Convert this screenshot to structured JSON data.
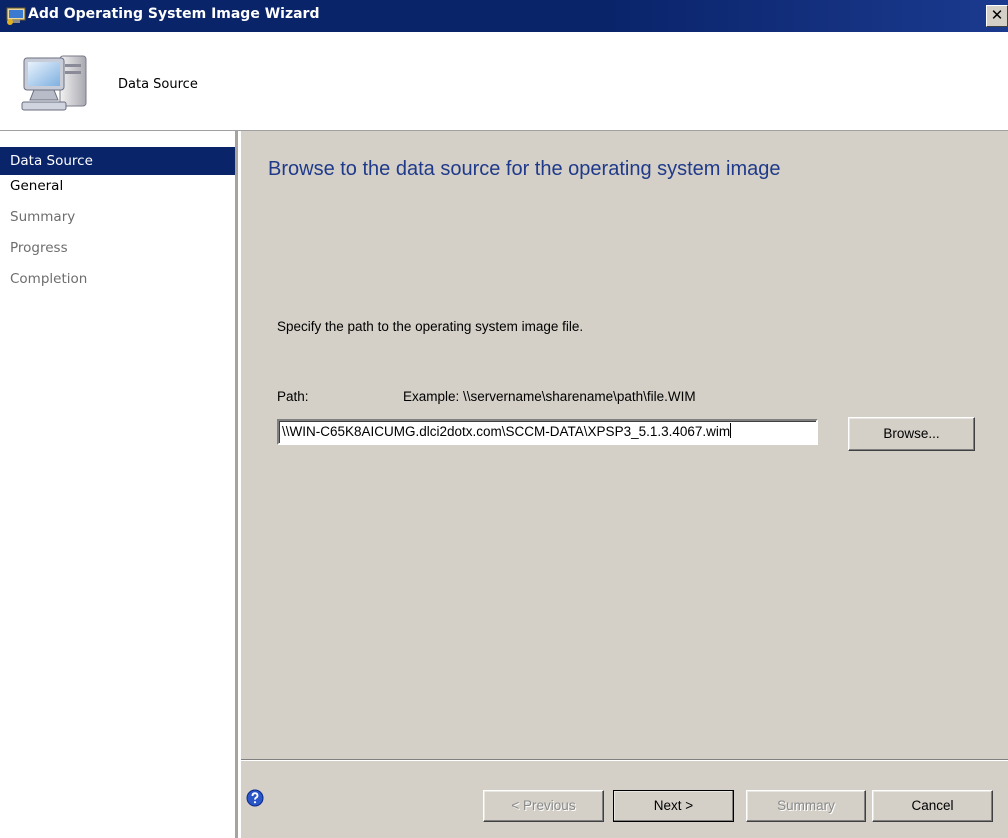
{
  "window": {
    "title": "Add Operating System Image Wizard",
    "close_label": "✕"
  },
  "header": {
    "title": "Data Source",
    "icon": "computer-icon"
  },
  "nav": {
    "items": [
      {
        "label": "Data Source",
        "state": "active"
      },
      {
        "label": "General",
        "state": "enabled"
      },
      {
        "label": "Summary",
        "state": "disabled"
      },
      {
        "label": "Progress",
        "state": "disabled"
      },
      {
        "label": "Completion",
        "state": "disabled"
      }
    ]
  },
  "content": {
    "heading": "Browse to the data source for the operating system image",
    "instruction": "Specify the path to the operating system image file.",
    "path_label": "Path:",
    "path_example": "Example: \\\\servername\\sharename\\path\\file.WIM",
    "path_value": "\\\\WIN-C65K8AICUMG.dlci2dotx.com\\SCCM-DATA\\XPSP3_5.1.3.4067.wim",
    "browse_label": "Browse..."
  },
  "footer": {
    "help_icon": "help-icon",
    "previous_label": "< Previous",
    "next_label": "Next >",
    "summary_label": "Summary",
    "cancel_label": "Cancel"
  },
  "colors": {
    "titlebar": "#0a246a",
    "nav_active": "#0a246a",
    "heading": "#1f3a8a",
    "panel": "#d4d0c8"
  }
}
